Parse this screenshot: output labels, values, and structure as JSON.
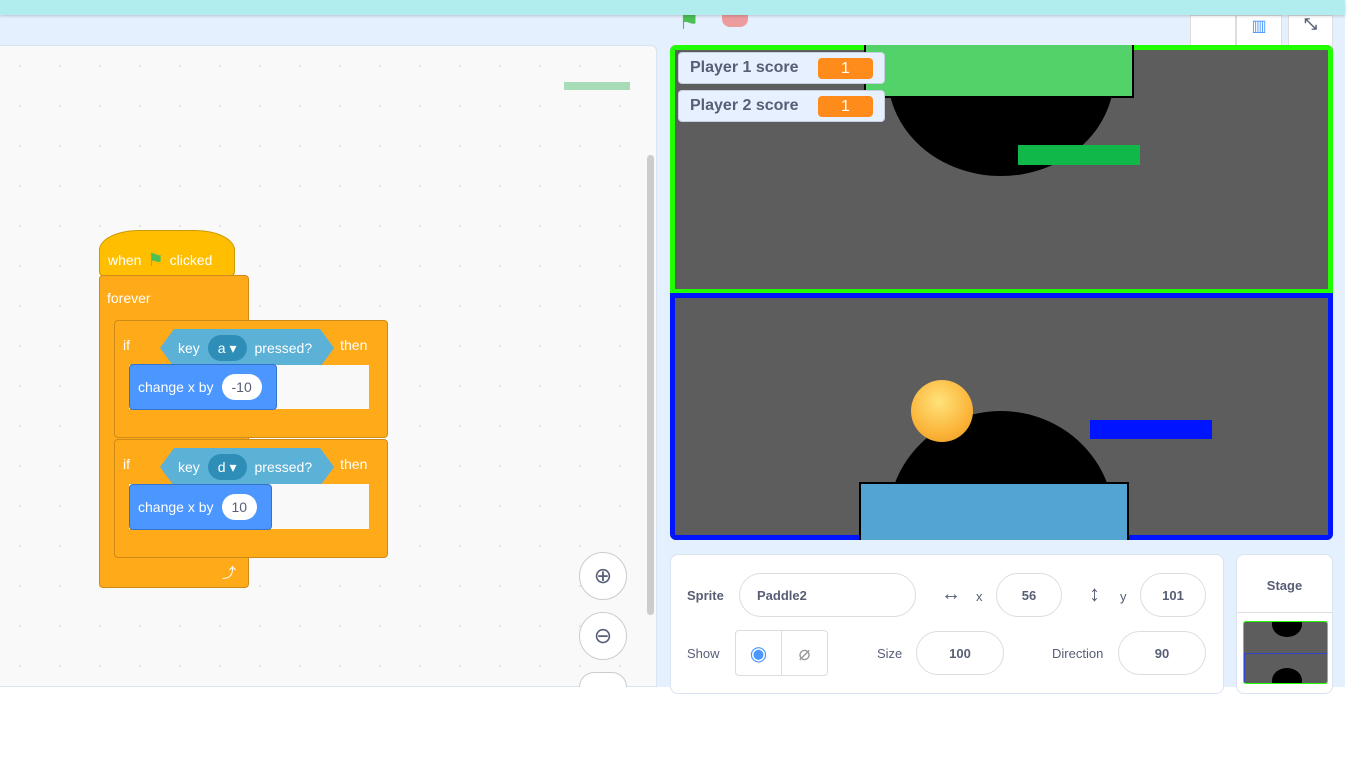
{
  "code": {
    "hat": {
      "when": "when",
      "clicked": "clicked"
    },
    "forever": "forever",
    "if1": {
      "if": "if",
      "key": "key",
      "key_value": "a",
      "pressed": "pressed?",
      "then": "then",
      "change_label": "change x by",
      "change_value": "-10"
    },
    "if2": {
      "if": "if",
      "key": "key",
      "key_value": "d",
      "pressed": "pressed?",
      "then": "then",
      "change_label": "change x by",
      "change_value": "10"
    }
  },
  "monitors": [
    {
      "label": "Player 1 score",
      "value": "1"
    },
    {
      "label": "Player 2 score",
      "value": "1"
    }
  ],
  "sprite_info": {
    "sprite_label": "Sprite",
    "sprite_name": "Paddle2",
    "x_label": "x",
    "x": "56",
    "y_label": "y",
    "y": "101",
    "show_label": "Show",
    "size_label": "Size",
    "size": "100",
    "direction_label": "Direction",
    "direction": "90"
  },
  "stage_panel": {
    "title": "Stage"
  },
  "colors": {
    "top_border": "#22ff00",
    "bottom_border": "#0015ff",
    "block_orange": "#ffab19",
    "block_blue": "#4c97ff"
  }
}
